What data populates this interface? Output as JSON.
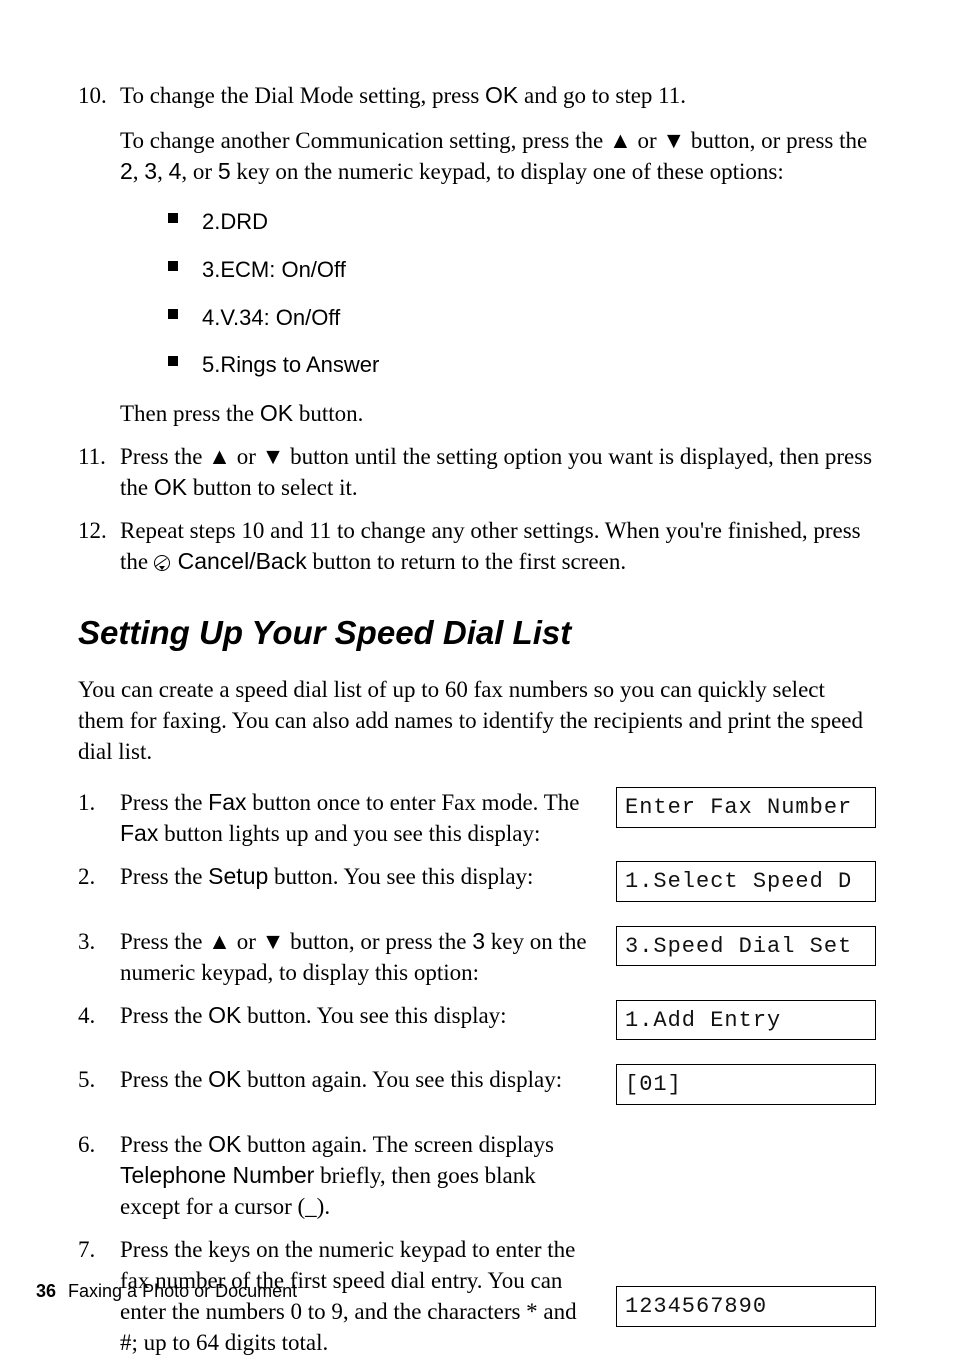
{
  "steps10": {
    "num": "10.",
    "line1_a": "To change the Dial Mode setting, press ",
    "ok": "OK",
    "line1_b": " and go to step 11.",
    "para2_a": "To change another Communication setting, press the ",
    "up": "▲",
    "para2_b": " or ",
    "down": "▼",
    "para2_c": " button, or press the ",
    "k2": "2",
    "c1": ", ",
    "k3": "3",
    "c2": ", ",
    "k4": "4",
    "c3": ", or ",
    "k5": "5",
    "para2_d": " key on the numeric keypad, to display one of these options:",
    "opts": {
      "a": "2.DRD",
      "b": "3.ECM: On/Off",
      "c": "4.V.34: On/Off",
      "d": "5.Rings to Answer"
    },
    "then_a": "Then press the ",
    "then_b": " button."
  },
  "steps11": {
    "num": "11.",
    "a": "Press the ",
    "b": " or ",
    "c": " button until the setting option you want is displayed, then press the ",
    "d": " button to select it."
  },
  "steps12": {
    "num": "12.",
    "a": "Repeat steps 10 and 11 to change any other settings. When you're finished, press the ",
    "cancel": "Cancel/Back",
    "b": " button to return to the first screen."
  },
  "section_title": "Setting Up Your Speed Dial List",
  "intro": "You can create a speed dial list of up to 60 fax numbers so you can quickly select them for faxing. You can also add names to identify the recipients and print the speed dial list.",
  "sd1": {
    "num": "1.",
    "a": "Press the ",
    "fax": "Fax",
    "b": " button once to enter Fax mode. The ",
    "c": " button lights up and you see this display:"
  },
  "sd2": {
    "num": "2.",
    "a": "Press the ",
    "setup": "Setup",
    "b": " button. You see this display:"
  },
  "sd3": {
    "num": "3.",
    "a": "Press the ",
    "b": " or ",
    "c": " button, or press the ",
    "k3": "3",
    "d": " key on the numeric keypad, to display this option:"
  },
  "sd4": {
    "num": "4.",
    "a": "Press the ",
    "b": " button. You see this display:"
  },
  "sd5": {
    "num": "5.",
    "a": "Press the ",
    "b": " button again. You see this display:"
  },
  "sd6": {
    "num": "6.",
    "a": "Press the ",
    "b": " button again. The screen displays ",
    "tel": "Telephone Number",
    "c": " briefly, then goes blank except for a cursor (_)."
  },
  "sd7": {
    "num": "7.",
    "a": "Press the keys on the numeric keypad to enter the fax number of the first speed dial entry. You can enter the numbers 0 to 9, and the characters * and #; up to 64 digits total."
  },
  "lcd": {
    "enter": "Enter Fax Number",
    "select": "1.Select Speed D",
    "speed": "3.Speed Dial Set",
    "add": "1.Add Entry",
    "slot": "[01]",
    "digits": "1234567890"
  },
  "footer": {
    "page": "36",
    "chapter": "Faxing a Photo or Document"
  }
}
